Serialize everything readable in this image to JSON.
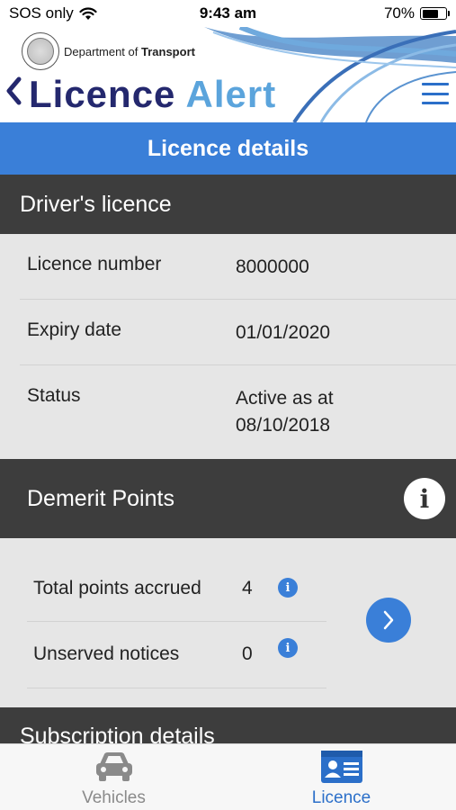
{
  "status_bar": {
    "carrier": "SOS only",
    "time": "9:43 am",
    "battery_text": "70%",
    "battery_level": 0.7
  },
  "header": {
    "department_prefix": "Department of",
    "department_bold": "Transport",
    "title_part1": "Licence",
    "title_part2": "Alert",
    "back_icon": "chevron-left-icon",
    "menu_icon": "hamburger-menu-icon"
  },
  "page_title": "Licence details",
  "drivers_licence": {
    "heading": "Driver's licence",
    "rows": [
      {
        "label": "Licence number",
        "value": "8000000"
      },
      {
        "label": "Expiry date",
        "value": "01/01/2020"
      },
      {
        "label": "Status",
        "value": "Active as at",
        "value2": "08/10/2018"
      }
    ]
  },
  "demerit": {
    "heading": "Demerit Points",
    "info_glyph": "i",
    "rows": [
      {
        "label": "Total points accrued",
        "value": "4",
        "info_glyph": "i"
      },
      {
        "label": "Unserved notices",
        "value": "0",
        "info_glyph": "i"
      }
    ]
  },
  "subscription": {
    "heading": "Subscription details"
  },
  "tabs": [
    {
      "label": "Vehicles",
      "icon": "car-icon",
      "active": false
    },
    {
      "label": "Licence",
      "icon": "licence-card-icon",
      "active": true
    }
  ],
  "colors": {
    "accent_blue": "#3a7fd8",
    "navy": "#24286e",
    "light_blue": "#5ba4dc",
    "section_dark": "#3d3d3d",
    "panel_grey": "#e6e6e6"
  }
}
